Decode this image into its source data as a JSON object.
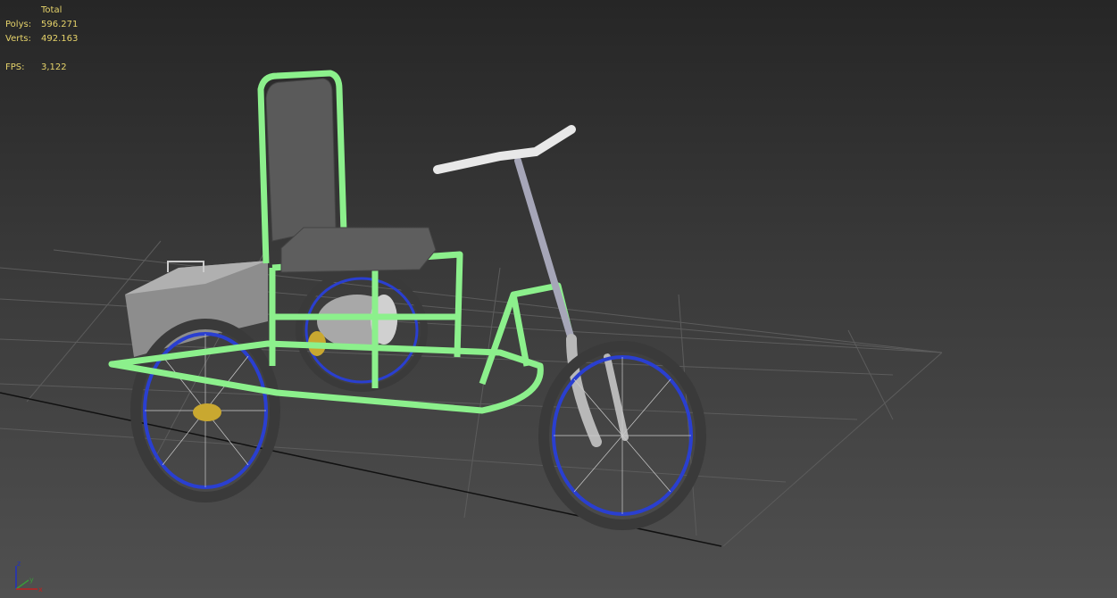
{
  "stats": {
    "header": "Total",
    "polys_label": "Polys:",
    "polys": "596.271",
    "verts_label": "Verts:",
    "verts": "492.163",
    "fps_label": "FPS:",
    "fps": "3,122"
  },
  "gizmo": {
    "z": "z",
    "y": "y",
    "x": "x"
  },
  "colors": {
    "stats_text": "#e6d36a",
    "selection": "#8cf08c",
    "rim": "#2a3fd0",
    "grid": "#5a5a5a"
  }
}
